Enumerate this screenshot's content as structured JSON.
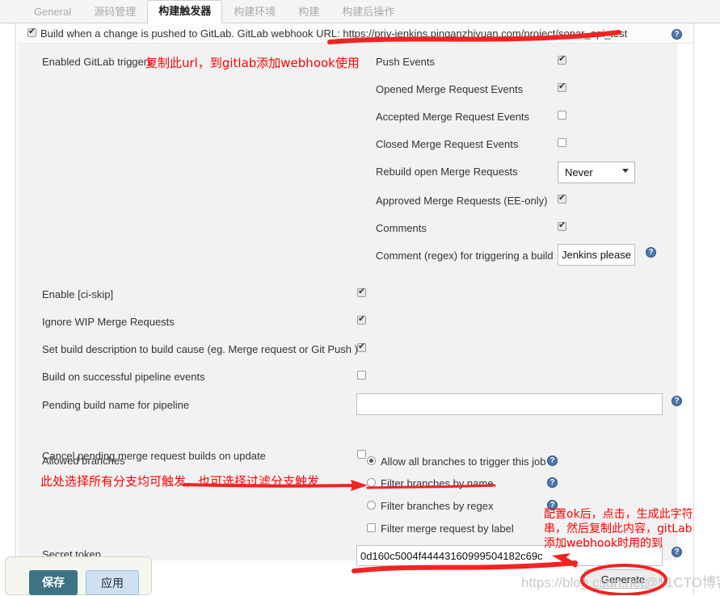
{
  "tabs": [
    {
      "label": "General",
      "active": false
    },
    {
      "label": "源码管理",
      "active": false
    },
    {
      "label": "构建触发器",
      "active": true
    },
    {
      "label": "构建环境",
      "active": false
    },
    {
      "label": "构建",
      "active": false
    },
    {
      "label": "构建后操作",
      "active": false
    }
  ],
  "gitlab_trigger": {
    "checkbox_label": "Build when a change is pushed to GitLab. GitLab webhook URL: https://priv-jenkins.pinganzhiyuan.com/project/sonar_api_test",
    "checked": true,
    "help": "?"
  },
  "enabled_triggers": {
    "label": "Enabled GitLab triggers",
    "annotation": "复制此url，到gitlab添加webhook使用",
    "events": [
      {
        "label": "Push Events",
        "checked": true
      },
      {
        "label": "Opened Merge Request Events",
        "checked": true
      },
      {
        "label": "Accepted Merge Request Events",
        "checked": false
      },
      {
        "label": "Closed Merge Request Events",
        "checked": false
      }
    ],
    "rebuild": {
      "label": "Rebuild open Merge Requests",
      "value": "Never"
    },
    "events2": [
      {
        "label": "Approved Merge Requests (EE-only)",
        "checked": true
      },
      {
        "label": "Comments",
        "checked": true
      }
    ],
    "comment_regex": {
      "label": "Comment (regex) for triggering a build",
      "value": "Jenkins please r"
    }
  },
  "options": [
    {
      "label": "Enable [ci-skip]",
      "checked": true
    },
    {
      "label": "Ignore WIP Merge Requests",
      "checked": true
    },
    {
      "label": "Set build description to build cause (eg. Merge request or Git Push )",
      "checked": true
    },
    {
      "label": "Build on successful pipeline events",
      "checked": false
    }
  ],
  "pending_build": {
    "label": "Pending build name for pipeline",
    "value": "",
    "placeholder": ""
  },
  "cancel_pending": {
    "label": "Cancel pending merge request builds on update",
    "checked": false
  },
  "allowed_branches": {
    "label": "Allowed branches",
    "annotation": "此处选择所有分支均可触发，也可选择过滤分支触发",
    "radios": [
      {
        "label": "Allow all branches to trigger this job",
        "selected": true,
        "type": "radio"
      },
      {
        "label": "Filter branches by name",
        "selected": false,
        "type": "radio"
      },
      {
        "label": "Filter branches by regex",
        "selected": false,
        "type": "radio"
      },
      {
        "label": "Filter merge request by label",
        "selected": false,
        "type": "checkbox"
      }
    ]
  },
  "secret_token": {
    "label": "Secret token",
    "value": "0d160c5004f44443160999504182c69c",
    "generate_label": "Generate",
    "annotation_line1": "配置ok后，点击，生成此字符",
    "annotation_line2": "串，然后复制此内容，gitLab",
    "annotation_line3": "添加webhook时用的到"
  },
  "footer": {
    "save_label": "保存",
    "apply_label": "应用"
  },
  "watermark": "https://blog.csdn.net@51CTO博客",
  "colors": {
    "accent_red": "#ff0000",
    "save_button": "#3d7382",
    "apply_button": "#cfe0f1",
    "panel_bg": "#f2f2f2",
    "help_icon": "#4f76ad"
  }
}
